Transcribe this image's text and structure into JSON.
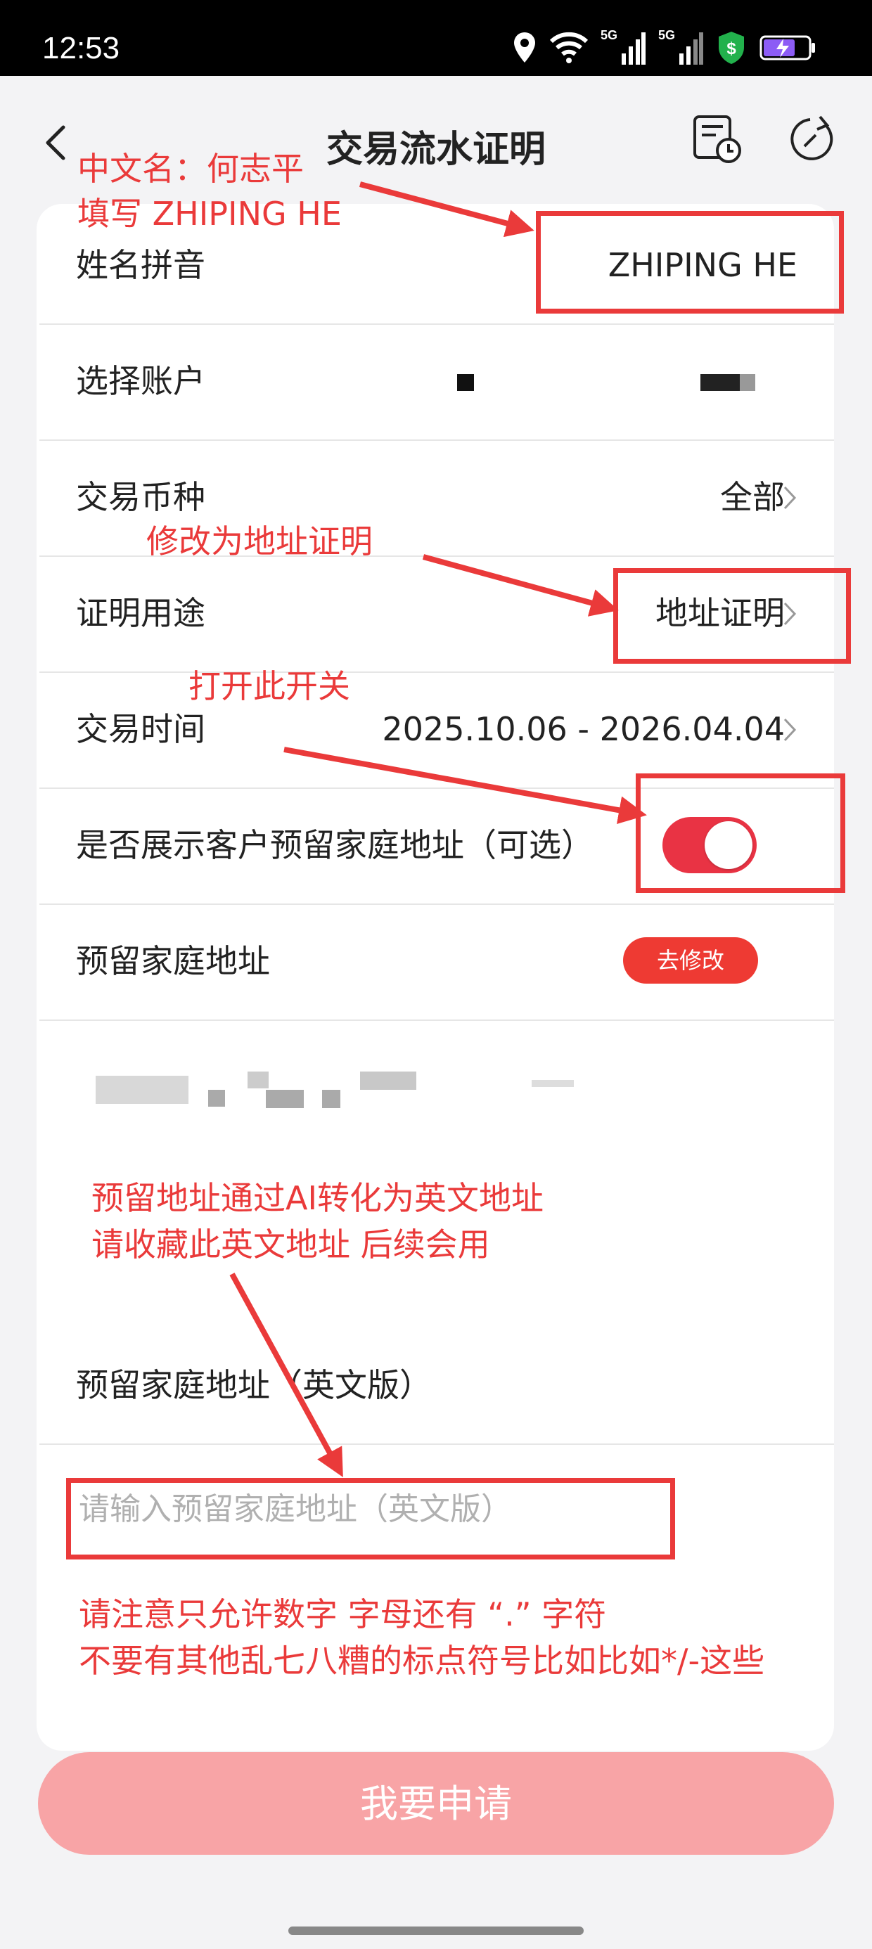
{
  "status_bar": {
    "time": "12:53",
    "network_1": "5G",
    "network_2": "5G",
    "icons": [
      "location-icon",
      "wifi-icon",
      "signal-5g-icon",
      "signal-5g-icon",
      "security-shield-icon",
      "battery-charging-icon"
    ]
  },
  "header": {
    "title": "交易流水证明",
    "back_icon": "chevron-left-icon",
    "record_icon": "document-clock-icon",
    "refresh_icon": "refresh-icon"
  },
  "form": {
    "name_pinyin": {
      "label": "姓名拼音",
      "value": "ZHIPING HE"
    },
    "account": {
      "label": "选择账户"
    },
    "currency": {
      "label": "交易币种",
      "value": "全部"
    },
    "purpose": {
      "label": "证明用途",
      "value": "地址证明"
    },
    "period": {
      "label": "交易时间",
      "value": "2025.10.06 - 2026.04.04"
    },
    "show_address": {
      "label": "是否展示客户预留家庭地址（可选）",
      "enabled": true
    },
    "home_address": {
      "label": "预留家庭地址",
      "edit_button": "去修改"
    },
    "home_address_en": {
      "label": "预留家庭地址（英文版）",
      "placeholder": "请输入预留家庭地址（英文版）"
    }
  },
  "submit_button": "我要申请",
  "annotations": {
    "note_name_1": "中文名：何志平",
    "note_name_2": "填写 ZHIPING HE",
    "note_purpose": "修改为地址证明",
    "note_toggle": "打开此开关",
    "note_ai_1": "预留地址通过AI转化为英文地址",
    "note_ai_2": "请收藏此英文地址 后续会用",
    "note_rule_1": "请注意只允许数字 字母还有 “.” 字符",
    "note_rule_2": "不要有其他乱七八糟的标点符号比如比如*/-这些"
  },
  "colors": {
    "accent_red": "#e93344",
    "annotation_red": "#ea3a3a",
    "button_disabled": "#f8a4a6",
    "background": "#f3f3f5"
  }
}
